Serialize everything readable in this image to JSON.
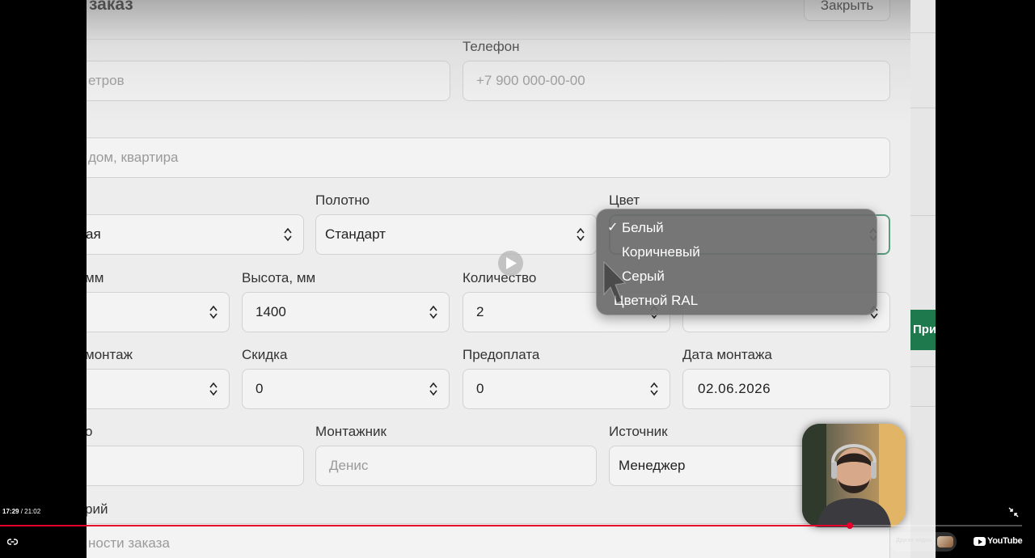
{
  "modal": {
    "title": "заказ",
    "close_label": "Закрыть",
    "fields": {
      "name_placeholder": "етров",
      "phone_label": "Телефон",
      "phone_placeholder": "+7 900 000-00-00",
      "address_placeholder": "дом, квартира",
      "type_value": "ая",
      "canvas_label": "Полотно",
      "canvas_value": "Стандарт",
      "color_label": "Цвет",
      "width_label": "мм",
      "height_label": "Высота, мм",
      "height_value": "1400",
      "qty_label": "Количество",
      "qty_value": "2",
      "mount_label": "монтаж",
      "discount_label": "Скидка",
      "discount_value": "0",
      "prepay_label": "Предоплата",
      "prepay_value": "0",
      "date_label": "Дата монтажа",
      "date_value": "02.06.2026",
      "misc_label": "о",
      "installer_label": "Монтажник",
      "installer_placeholder": "Денис",
      "source_label": "Источник",
      "source_value": "Менеджер",
      "comment_label": "рий",
      "comment_placeholder": "ности заказа"
    },
    "color_dropdown": {
      "options": [
        "Белый",
        "Коричневый",
        "Серый",
        "Цветной RAL"
      ],
      "selected": "Белый",
      "check_glyph": "✓"
    }
  },
  "page_behind": {
    "button_fragment": "При"
  },
  "player": {
    "current_time": "17:29",
    "separator": " / ",
    "duration": "21:02",
    "progress": 0.8312,
    "other_videos_label": "Другие видео",
    "brand": "YouTube"
  }
}
